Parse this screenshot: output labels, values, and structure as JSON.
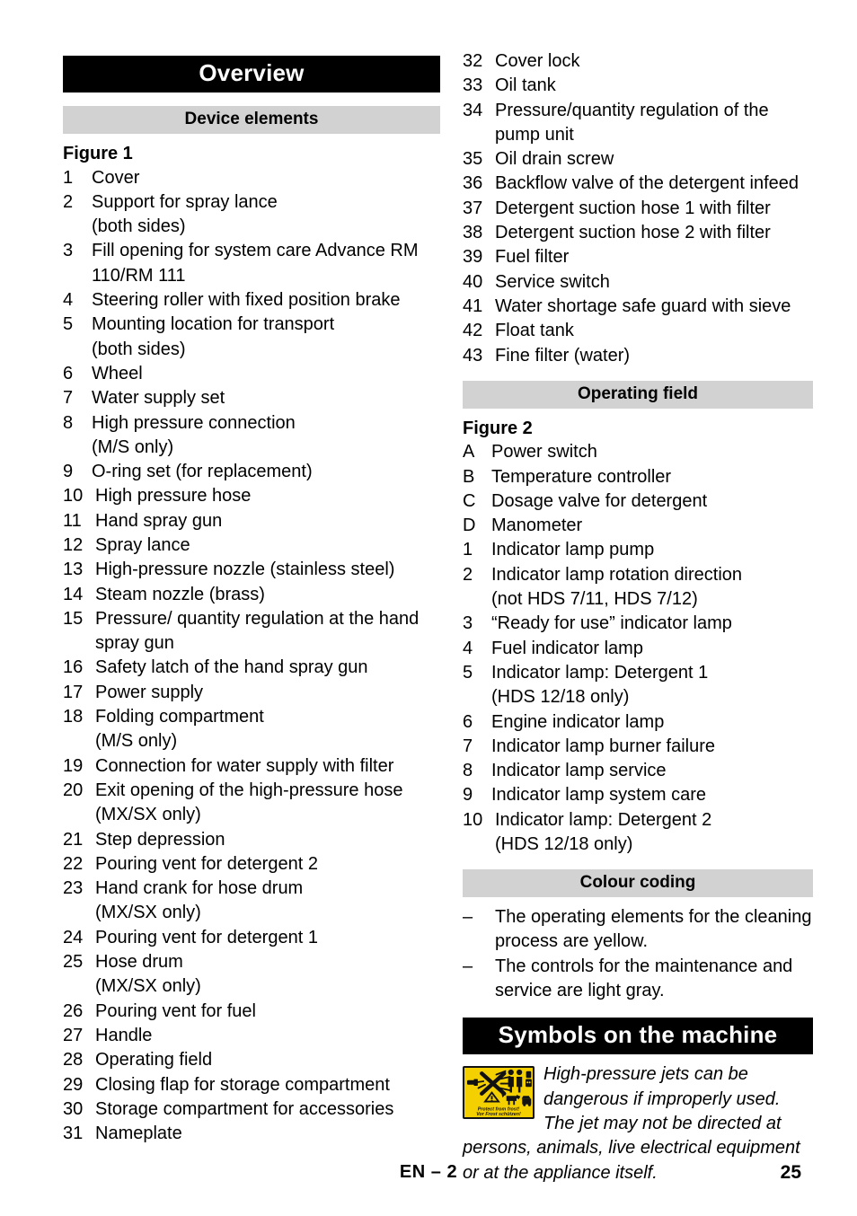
{
  "document": {
    "language_code": "EN"
  },
  "left_column": {
    "main_heading": "Overview",
    "section_heading": "Device elements",
    "figure_label": "Figure 1",
    "items": [
      {
        "num": "1",
        "text": "Cover"
      },
      {
        "num": "2",
        "text": "Support for spray lance",
        "sub": "(both sides)"
      },
      {
        "num": "3",
        "text": "Fill opening for system care Advance RM 110/RM 111"
      },
      {
        "num": "4",
        "text": "Steering roller with fixed position brake"
      },
      {
        "num": "5",
        "text": "Mounting location for transport",
        "sub": "(both sides)"
      },
      {
        "num": "6",
        "text": "Wheel"
      },
      {
        "num": "7",
        "text": "Water supply set"
      },
      {
        "num": "8",
        "text": "High pressure connection",
        "sub": "(M/S only)"
      },
      {
        "num": "9",
        "text": "O-ring set (for replacement)"
      },
      {
        "num": "10",
        "text": "High pressure hose"
      },
      {
        "num": "11",
        "text": "Hand spray gun"
      },
      {
        "num": "12",
        "text": "Spray lance"
      },
      {
        "num": "13",
        "text": "High-pressure nozzle (stainless steel)"
      },
      {
        "num": "14",
        "text": "Steam nozzle (brass)"
      },
      {
        "num": "15",
        "text": "Pressure/ quantity regulation at the hand spray gun"
      },
      {
        "num": "16",
        "text": "Safety latch of the hand spray gun"
      },
      {
        "num": "17",
        "text": "Power supply"
      },
      {
        "num": "18",
        "text": "Folding compartment",
        "sub": "(M/S only)"
      },
      {
        "num": "19",
        "text": "Connection for water supply with filter"
      },
      {
        "num": "20",
        "text": "Exit opening of the high-pressure hose",
        "sub": "(MX/SX only)"
      },
      {
        "num": "21",
        "text": "Step depression"
      },
      {
        "num": "22",
        "text": "Pouring vent for detergent 2"
      },
      {
        "num": "23",
        "text": "Hand crank for hose drum",
        "sub": "(MX/SX only)"
      },
      {
        "num": "24",
        "text": "Pouring vent for detergent 1"
      },
      {
        "num": "25",
        "text": "Hose drum",
        "sub": "(MX/SX only)"
      },
      {
        "num": "26",
        "text": "Pouring vent for fuel"
      },
      {
        "num": "27",
        "text": "Handle"
      },
      {
        "num": "28",
        "text": "Operating field"
      },
      {
        "num": "29",
        "text": "Closing flap for storage compartment"
      },
      {
        "num": "30",
        "text": "Storage compartment for accessories"
      },
      {
        "num": "31",
        "text": "Nameplate"
      }
    ]
  },
  "right_column": {
    "device_elements_continued": [
      {
        "num": "32",
        "text": "Cover lock"
      },
      {
        "num": "33",
        "text": "Oil tank"
      },
      {
        "num": "34",
        "text": "Pressure/quantity regulation of the pump unit"
      },
      {
        "num": "35",
        "text": "Oil drain screw"
      },
      {
        "num": "36",
        "text": "Backflow valve of the detergent infeed"
      },
      {
        "num": "37",
        "text": "Detergent suction hose 1 with filter"
      },
      {
        "num": "38",
        "text": "Detergent suction hose 2 with filter"
      },
      {
        "num": "39",
        "text": "Fuel filter"
      },
      {
        "num": "40",
        "text": "Service switch"
      },
      {
        "num": "41",
        "text": "Water shortage safe guard with sieve"
      },
      {
        "num": "42",
        "text": "Float tank"
      },
      {
        "num": "43",
        "text": "Fine filter (water)"
      }
    ],
    "operating_field": {
      "section_heading": "Operating field",
      "figure_label": "Figure 2",
      "items": [
        {
          "num": "A",
          "text": "Power switch"
        },
        {
          "num": "B",
          "text": "Temperature controller"
        },
        {
          "num": "C",
          "text": "Dosage valve for detergent"
        },
        {
          "num": "D",
          "text": "Manometer"
        },
        {
          "num": "1",
          "text": "Indicator lamp pump"
        },
        {
          "num": "2",
          "text": "Indicator lamp rotation direction",
          "sub": "(not HDS 7/11, HDS 7/12)"
        },
        {
          "num": "3",
          "text": "“Ready for use” indicator lamp"
        },
        {
          "num": "4",
          "text": "Fuel indicator lamp"
        },
        {
          "num": "5",
          "text": "Indicator lamp: Detergent 1",
          "sub": "(HDS 12/18 only)"
        },
        {
          "num": "6",
          "text": "Engine indicator lamp"
        },
        {
          "num": "7",
          "text": "Indicator lamp burner failure"
        },
        {
          "num": "8",
          "text": "Indicator lamp service"
        },
        {
          "num": "9",
          "text": "Indicator lamp system care"
        },
        {
          "num": "10",
          "text": "Indicator lamp: Detergent 2",
          "sub": "(HDS 12/18 only)"
        }
      ]
    },
    "colour_coding": {
      "section_heading": "Colour coding",
      "bullet_mark": "–",
      "bullets": [
        "The operating elements for the cleaning process are yellow.",
        "The controls for the maintenance and service are light gray."
      ]
    },
    "symbols": {
      "main_heading": "Symbols on the machine",
      "warning_text": "High-pressure jets can be dangerous if improperly used. The jet may not be directed at persons, animals, live electrical equipment or at the appliance itself.",
      "icon_label_line1": "Protect from frost!",
      "icon_label_line2": "Vor Frost schützen!",
      "icon_background": "#f5d000",
      "icon_foreground": "#121212"
    }
  },
  "footer": {
    "center": "EN – 2",
    "page_number": "25"
  }
}
